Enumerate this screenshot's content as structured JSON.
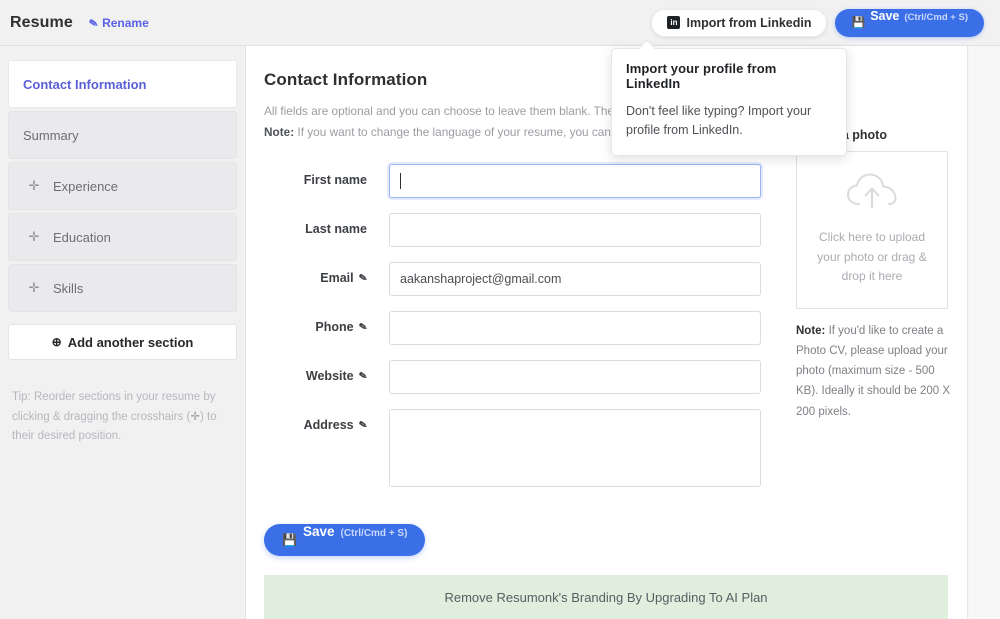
{
  "topbar": {
    "doc_title": "Resume",
    "rename_label": "Rename",
    "rename_icon": "pencil-icon",
    "import_linkedin_label": "Import from Linkedin",
    "linkedin_icon": "linkedin-icon",
    "linkedin_icon_glyph": "in",
    "save_label": "Save",
    "save_hint": "(Ctrl/Cmd + S)",
    "save_icon": "floppy-disk-icon",
    "save_icon_glyph": "💾"
  },
  "tooltip": {
    "title": "Import your profile from LinkedIn",
    "body": "Don't feel like typing? Import your profile from LinkedIn."
  },
  "sidebar": {
    "items": [
      {
        "label": "Contact Information",
        "active": true,
        "draggable": false
      },
      {
        "label": "Summary",
        "active": false,
        "draggable": false
      },
      {
        "label": "Experience",
        "active": false,
        "draggable": true
      },
      {
        "label": "Education",
        "active": false,
        "draggable": true
      },
      {
        "label": "Skills",
        "active": false,
        "draggable": true
      }
    ],
    "drag_icon": "arrows-move-icon",
    "drag_icon_glyph": "✛",
    "add_section_label": "Add another section",
    "add_section_icon": "plus-circle-icon",
    "add_section_icon_glyph": "⊕",
    "tip_text_1": "Tip: Reorder sections in your resume by clicking & dragging the crosshairs (",
    "tip_cross_glyph": "✛",
    "tip_text_2": ") to their desired position."
  },
  "main": {
    "page_title": "Contact Information",
    "desc_line1": "All fields are optional and you can choose to leave them blank. They",
    "desc_note_label": "Note:",
    "desc_line2": " If you want to change the language of your resume, you can ren",
    "pencil_icon": "pencil-icon",
    "fields": [
      {
        "label": "First name",
        "value": "",
        "editable_icon": false,
        "type": "text",
        "focused": true
      },
      {
        "label": "Last name",
        "value": "",
        "editable_icon": false,
        "type": "text",
        "focused": false
      },
      {
        "label": "Email",
        "value": "aakanshaproject@gmail.com",
        "editable_icon": true,
        "type": "text",
        "focused": false
      },
      {
        "label": "Phone",
        "value": "",
        "editable_icon": true,
        "type": "text",
        "focused": false
      },
      {
        "label": "Website",
        "value": "",
        "editable_icon": true,
        "type": "text",
        "focused": false
      },
      {
        "label": "Address",
        "value": "",
        "editable_icon": true,
        "type": "textarea",
        "focused": false
      }
    ],
    "save_label": "Save",
    "save_hint": "(Ctrl/Cmd + S)",
    "save_icon": "floppy-disk-icon",
    "save_icon_glyph": "💾",
    "banner_text": "Remove Resumonk's Branding By Upgrading To AI Plan",
    "banner_color": "#dfeedd"
  },
  "upload": {
    "title": "Upload a photo",
    "dropzone_icon": "cloud-upload-icon",
    "dropzone_text": "Click here to upload your photo or drag & drop it here",
    "note_label": "Note:",
    "note_text": " If you'd like to create a Photo CV, please upload your photo (maximum size - 500 KB). Ideally it should be 200 X 200 pixels."
  },
  "colors": {
    "accent_blue": "#3b6fe8",
    "link_purple": "#5b5fd6",
    "active_nav_text": "#5b5fd6",
    "banner_green": "#dfeedd",
    "chrome_gray": "#f1f1f2"
  }
}
